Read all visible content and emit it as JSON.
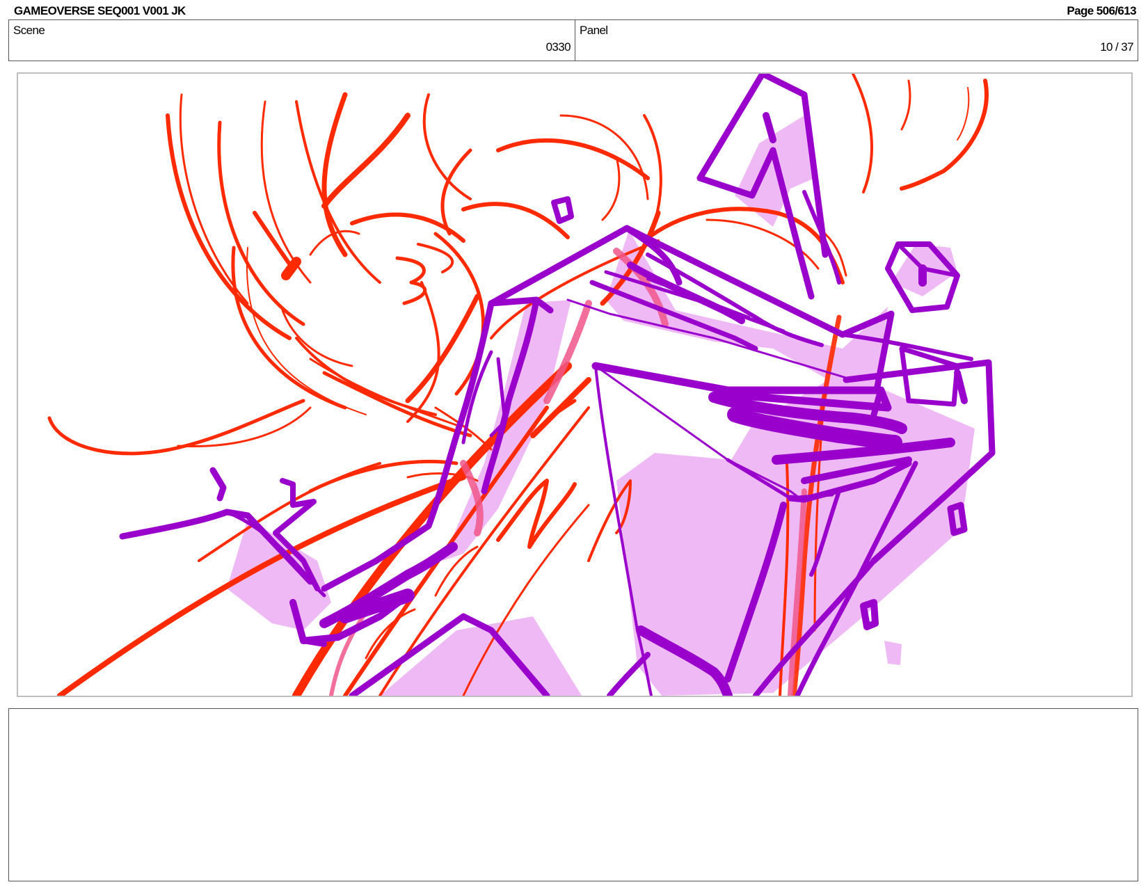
{
  "header": {
    "title": "GAMEOVERSE SEQ001 V001 JK",
    "page": "Page 506/613"
  },
  "scene": {
    "label": "Scene",
    "value": "0330"
  },
  "panel": {
    "label": "Panel",
    "value": "10 / 37"
  },
  "notes": {
    "text": ""
  },
  "colors": {
    "sketch_red": "#ff2a00",
    "sketch_purple": "#9a00cc",
    "fill_lilac": "#efb9f5",
    "frame_border": "#bdbdbd"
  }
}
